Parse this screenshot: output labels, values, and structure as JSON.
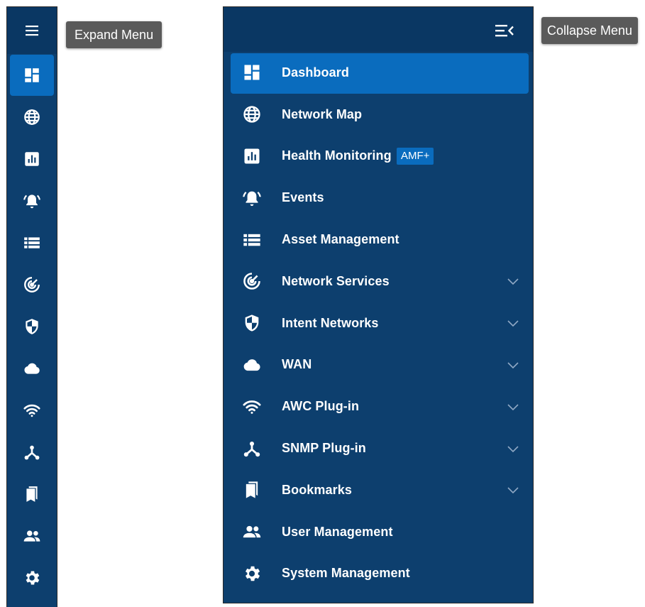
{
  "tooltips": {
    "expand": "Expand Menu",
    "collapse": "Collapse Menu"
  },
  "colors": {
    "sidebar": "#0d3f6e",
    "header": "#0a3763",
    "active": "#0a6cbe",
    "tooltip": "#5a5a5a"
  },
  "menu": {
    "items": [
      {
        "label": "Dashboard",
        "icon": "dashboard-icon",
        "active": true
      },
      {
        "label": "Network Map",
        "icon": "globe-icon"
      },
      {
        "label": "Health Monitoring",
        "icon": "bar-chart-icon",
        "badge": "AMF+"
      },
      {
        "label": "Events",
        "icon": "alarm-bell-icon"
      },
      {
        "label": "Asset Management",
        "icon": "list-icon"
      },
      {
        "label": "Network Services",
        "icon": "radar-icon",
        "expandable": true
      },
      {
        "label": "Intent Networks",
        "icon": "shield-icon",
        "expandable": true
      },
      {
        "label": "WAN",
        "icon": "cloud-icon",
        "expandable": true
      },
      {
        "label": "AWC Plug-in",
        "icon": "wifi-icon",
        "expandable": true
      },
      {
        "label": "SNMP Plug-in",
        "icon": "network-node-icon",
        "expandable": true
      },
      {
        "label": "Bookmarks",
        "icon": "bookmarks-icon",
        "expandable": true
      },
      {
        "label": "User Management",
        "icon": "users-icon"
      },
      {
        "label": "System Management",
        "icon": "gear-icon"
      }
    ]
  }
}
